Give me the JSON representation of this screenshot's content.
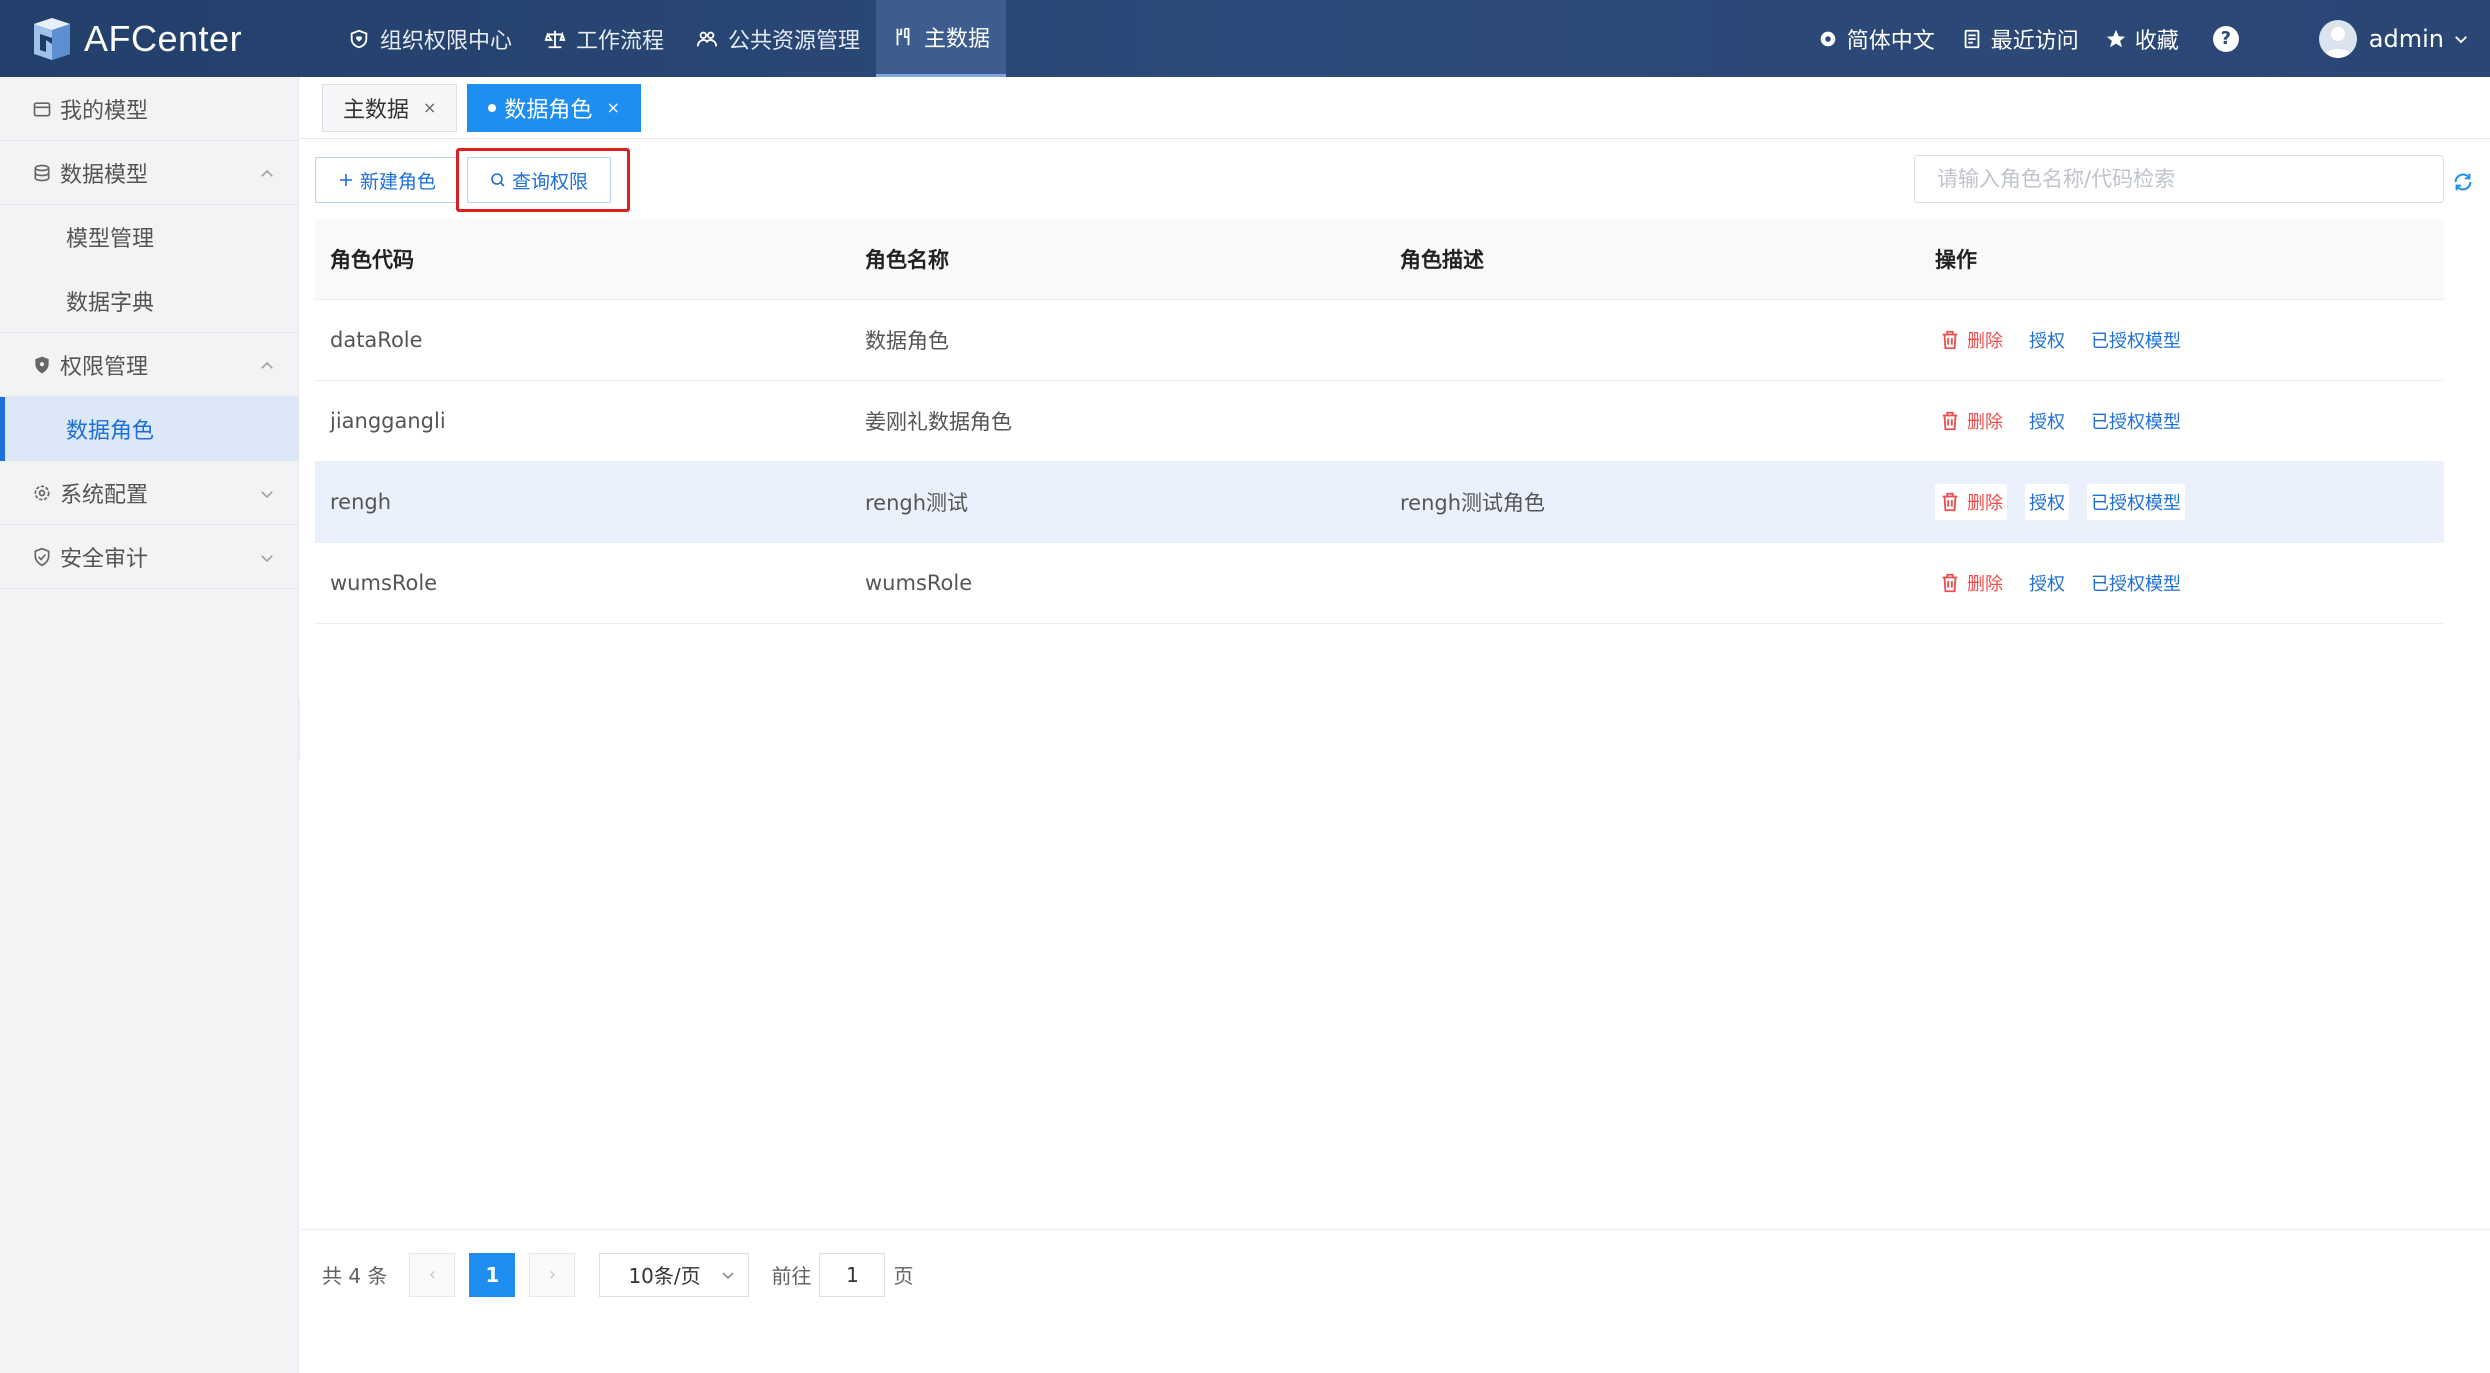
{
  "app": {
    "logo_text": "AFCenter"
  },
  "topnav": [
    {
      "label": "组织权限中心",
      "icon": "shield-heart-icon"
    },
    {
      "label": "工作流程",
      "icon": "balance-icon"
    },
    {
      "label": "公共资源管理",
      "icon": "users-icon"
    },
    {
      "label": "主数据",
      "icon": "data-icon",
      "active": true
    }
  ],
  "topright": {
    "language": "简体中文",
    "recent": "最近访问",
    "favorites": "收藏",
    "help": "?",
    "user": "admin"
  },
  "sidebar": {
    "my_model": "我的模型",
    "data_model": "数据模型",
    "model_manage": "模型管理",
    "data_dict": "数据字典",
    "perm_manage": "权限管理",
    "data_role": "数据角色",
    "sys_config": "系统配置",
    "security_audit": "安全审计"
  },
  "tabs": [
    {
      "label": "主数据",
      "close": "×"
    },
    {
      "label": "数据角色",
      "close": "×",
      "active": true
    }
  ],
  "toolbar": {
    "new_role": "新建角色",
    "query_perm": "查询权限",
    "search_placeholder": "请输入角色名称/代码检索"
  },
  "table": {
    "headers": [
      "角色代码",
      "角色名称",
      "角色描述",
      "操作"
    ],
    "rows": [
      {
        "code": "dataRole",
        "name": "数据角色",
        "desc": ""
      },
      {
        "code": "jianggangli",
        "name": "姜刚礼数据角色",
        "desc": ""
      },
      {
        "code": "rengh",
        "name": "rengh测试",
        "desc": "rengh测试角色"
      },
      {
        "code": "wumsRole",
        "name": "wumsRole",
        "desc": ""
      }
    ],
    "ops": {
      "delete": "删除",
      "authorize": "授权",
      "authorized_models": "已授权模型"
    }
  },
  "pager": {
    "total": "共 4 条",
    "prev": "‹",
    "current": "1",
    "next": "›",
    "page_size": "10条/页",
    "goto_prefix": "前往",
    "goto_value": "1",
    "goto_suffix": "页"
  },
  "colors": {
    "accent": "#1f8ef1",
    "topbar": "#2c4a79",
    "danger": "#ef4d4d",
    "highlight": "#e02020"
  }
}
